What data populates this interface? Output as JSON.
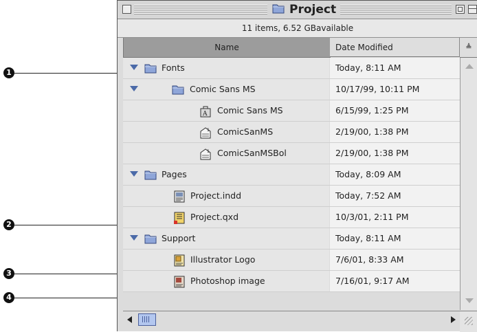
{
  "window": {
    "title": "Project",
    "info": "11 items, 6.52 GBavailable"
  },
  "columns": {
    "name": "Name",
    "date": "Date Modified",
    "sort_indicator": "≜"
  },
  "rows": [
    {
      "name": "Fonts",
      "date": "Today, 8:11 AM",
      "type": "folder",
      "expanded": true
    },
    {
      "name": "Comic Sans MS",
      "date": "10/17/99, 10:11 PM",
      "type": "folder",
      "expanded": true
    },
    {
      "name": "Comic Sans MS",
      "date": "6/15/99, 1:25 PM",
      "type": "font-suitcase"
    },
    {
      "name": "ComicSanMS",
      "date": "2/19/00, 1:38 PM",
      "type": "font-file"
    },
    {
      "name": "ComicSanMSBol",
      "date": "2/19/00, 1:38 PM",
      "type": "font-file"
    },
    {
      "name": "Pages",
      "date": "Today, 8:09 AM",
      "type": "folder",
      "expanded": true
    },
    {
      "name": "Project.indd",
      "date": "Today, 7:52 AM",
      "type": "indesign-doc"
    },
    {
      "name": "Project.qxd",
      "date": "10/3/01, 2:11 PM",
      "type": "quark-doc"
    },
    {
      "name": "Support",
      "date": "Today, 8:11 AM",
      "type": "folder",
      "expanded": true
    },
    {
      "name": "Illustrator Logo",
      "date": "7/6/01, 8:33 AM",
      "type": "illustrator-doc"
    },
    {
      "name": "Photoshop image",
      "date": "7/16/01, 9:17 AM",
      "type": "photoshop-doc"
    }
  ],
  "callouts": [
    "1",
    "2",
    "3",
    "4"
  ]
}
